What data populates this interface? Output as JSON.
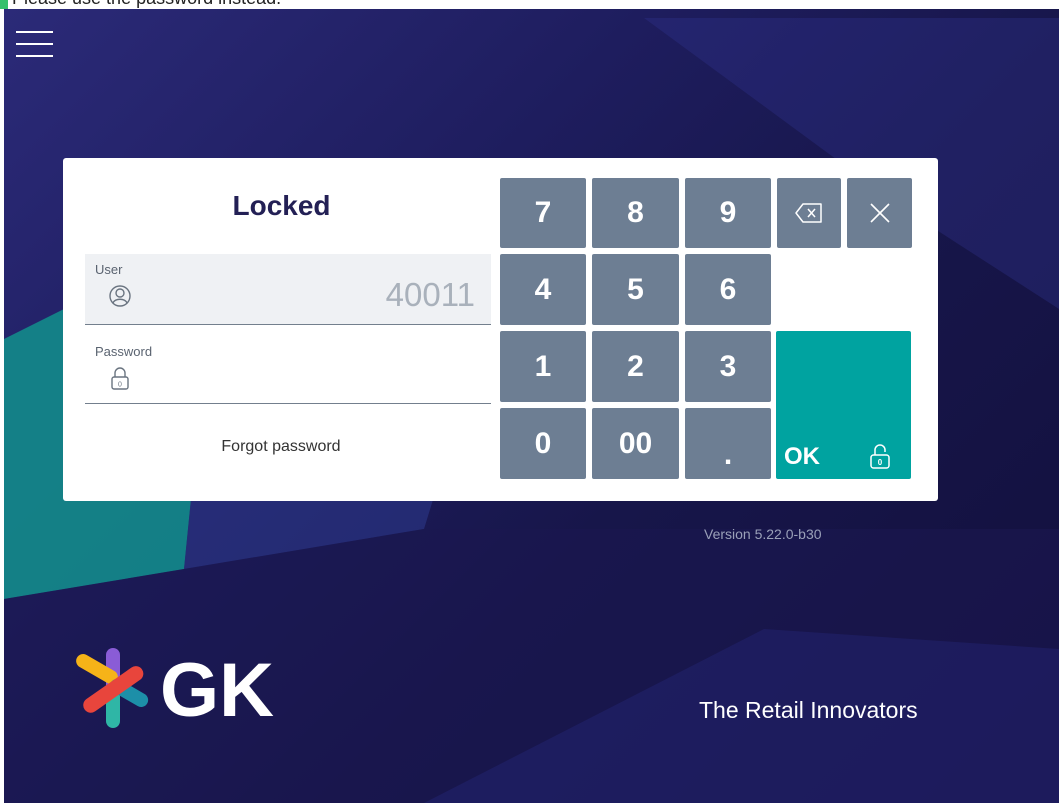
{
  "notification": {
    "message": "Please use the password instead."
  },
  "dialog": {
    "title": "Locked",
    "user": {
      "label": "User",
      "value": "40011"
    },
    "password": {
      "label": "Password",
      "value": ""
    },
    "forgot_label": "Forgot password"
  },
  "keypad": {
    "k7": "7",
    "k8": "8",
    "k9": "9",
    "k4": "4",
    "k5": "5",
    "k6": "6",
    "k1": "1",
    "k2": "2",
    "k3": "3",
    "k0": "0",
    "k00": "00",
    "kdot": ".",
    "ok": "OK",
    "icons": {
      "backspace": "backspace-icon",
      "clear": "close-icon",
      "unlock": "lock-icon"
    }
  },
  "footer": {
    "version": "Version 5.22.0-b30",
    "brand": "GK",
    "tagline": "The Retail Innovators"
  },
  "colors": {
    "key": "#6d7e93",
    "ok": "#00a3a0",
    "background": "#1e1d5e",
    "notification": "#36c06d"
  }
}
